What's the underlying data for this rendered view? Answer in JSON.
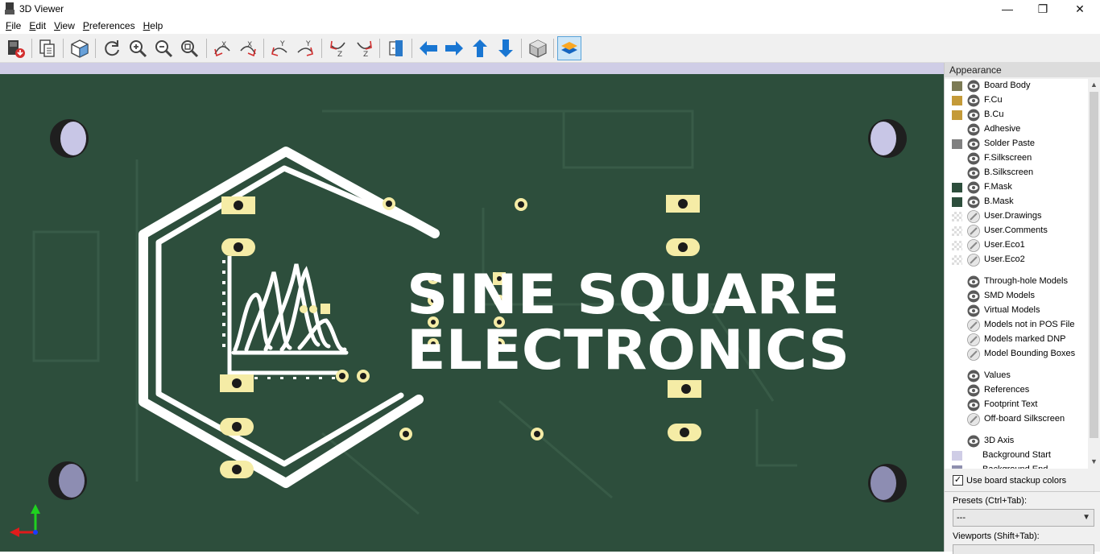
{
  "window": {
    "title": "3D Viewer",
    "minimize": "—",
    "restore": "❐",
    "close": "✕"
  },
  "menu": {
    "items": [
      {
        "first": "F",
        "rest": "ile"
      },
      {
        "first": "E",
        "rest": "dit"
      },
      {
        "first": "V",
        "rest": "iew"
      },
      {
        "first": "P",
        "rest": "references"
      },
      {
        "first": "H",
        "rest": "elp"
      }
    ]
  },
  "toolbar": {
    "icons": [
      "export-image-icon",
      "copy-to-clipboard-icon",
      "render-toggle-icon",
      "reload-icon",
      "zoom-in-icon",
      "zoom-out-icon",
      "zoom-fit-icon",
      "rotate-x-cw-icon",
      "rotate-x-ccw-icon",
      "rotate-y-cw-icon",
      "rotate-y-ccw-icon",
      "rotate-z-cw-icon",
      "rotate-z-ccw-icon",
      "flip-board-icon",
      "pan-left-icon",
      "pan-right-icon",
      "pan-up-icon",
      "pan-down-icon",
      "orthographic-icon",
      "toggle-layers-icon"
    ],
    "active": "toggle-layers-icon"
  },
  "board": {
    "logo_line1": "SINE SQUARE",
    "logo_line2": "ELECTRONICS",
    "pcb_color": "#2d4e3c",
    "silk_color": "#ffffff",
    "pad_color": "#f5eca6",
    "background_start": "#cfcde6"
  },
  "appearance": {
    "title": "Appearance",
    "rows": [
      {
        "label": "Board Body",
        "swatch": "#7c7a54",
        "eye": "visible"
      },
      {
        "label": "F.Cu",
        "swatch": "#c49a38",
        "eye": "visible"
      },
      {
        "label": "B.Cu",
        "swatch": "#c49a38",
        "eye": "visible"
      },
      {
        "label": "Adhesive",
        "swatch": "",
        "eye": "visible"
      },
      {
        "label": "Solder Paste",
        "swatch": "#808080",
        "eye": "visible"
      },
      {
        "label": "F.Silkscreen",
        "swatch": "",
        "eye": "visible"
      },
      {
        "label": "B.Silkscreen",
        "swatch": "",
        "eye": "visible"
      },
      {
        "label": "F.Mask",
        "swatch": "#2d4e3c",
        "eye": "visible"
      },
      {
        "label": "B.Mask",
        "swatch": "#2d4e3c",
        "eye": "visible"
      },
      {
        "label": "User.Drawings",
        "swatch": "checker",
        "eye": "hidden"
      },
      {
        "label": "User.Comments",
        "swatch": "checker",
        "eye": "hidden"
      },
      {
        "label": "User.Eco1",
        "swatch": "checker",
        "eye": "hidden"
      },
      {
        "label": "User.Eco2",
        "swatch": "checker",
        "eye": "hidden"
      },
      {
        "label": "Through-hole Models",
        "swatch": "",
        "eye": "visible"
      },
      {
        "label": "SMD Models",
        "swatch": "",
        "eye": "visible"
      },
      {
        "label": "Virtual Models",
        "swatch": "",
        "eye": "visible"
      },
      {
        "label": "Models not in POS File",
        "swatch": "",
        "eye": "hidden"
      },
      {
        "label": "Models marked DNP",
        "swatch": "",
        "eye": "hidden"
      },
      {
        "label": "Model Bounding Boxes",
        "swatch": "",
        "eye": "hidden"
      },
      {
        "label": "Values",
        "swatch": "",
        "eye": "visible"
      },
      {
        "label": "References",
        "swatch": "",
        "eye": "visible"
      },
      {
        "label": "Footprint Text",
        "swatch": "",
        "eye": "visible"
      },
      {
        "label": "Off-board Silkscreen",
        "swatch": "",
        "eye": "hidden"
      },
      {
        "label": "3D Axis",
        "swatch": "",
        "eye": "visible"
      },
      {
        "label": "Background Start",
        "swatch": "#cfcde6",
        "eye": "none"
      },
      {
        "label": "Background End",
        "swatch": "#8e8fae",
        "eye": "none"
      }
    ],
    "use_stackup": "Use board stackup colors",
    "use_stackup_checked": true,
    "presets_label": "Presets (Ctrl+Tab):",
    "presets_value": "---",
    "viewports_label": "Viewports (Shift+Tab):"
  }
}
